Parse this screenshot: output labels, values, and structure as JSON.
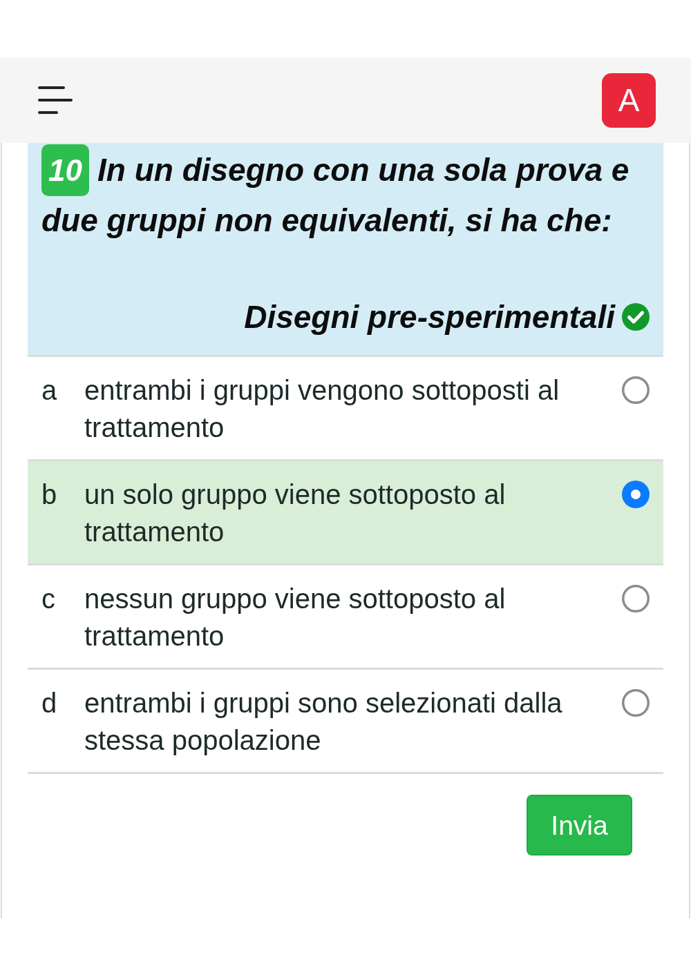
{
  "header": {
    "avatar": "A"
  },
  "question": {
    "number": "10",
    "text": "In un disegno con una sola prova e due gruppi non equivalenti, si ha che:",
    "answer": {
      "text": "Disegni pre-sperimentali",
      "correct": true
    }
  },
  "options": [
    {
      "letter": "a",
      "text": "entrambi i gruppi vengono sottoposti al trattamento",
      "selected": false
    },
    {
      "letter": "b",
      "text": "un solo gruppo viene sottoposto al trattamento",
      "selected": true
    },
    {
      "letter": "c",
      "text": "nessun gruppo viene sottoposto al trattamento",
      "selected": false
    },
    {
      "letter": "d",
      "text": "entrambi i gruppi sono selezionati dalla stessa popolazione",
      "selected": false
    }
  ],
  "submit_button": {
    "label": "Invia"
  }
}
